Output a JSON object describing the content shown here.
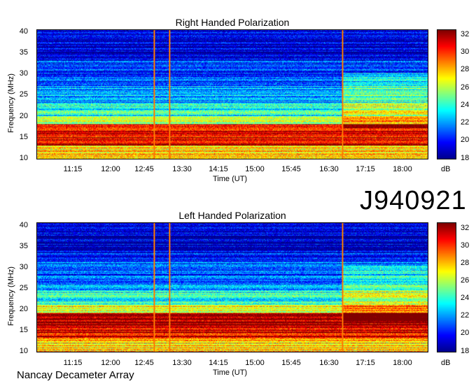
{
  "page": {
    "identifier": "J940921",
    "instrument": "Nancay Decameter Array"
  },
  "colors": {
    "colormap": [
      "#00008f",
      "#0000ff",
      "#0080ff",
      "#00ffff",
      "#80ff80",
      "#ffff00",
      "#ff8000",
      "#ff0000",
      "#800000"
    ],
    "background": "#ffffff"
  },
  "chart_data": [
    {
      "type": "heatmap",
      "title": "Right Handed Polarization",
      "xlabel": "Time (UT)",
      "ylabel": "Frequency (MHz)",
      "x_ticks": [
        "11:15",
        "12:00",
        "12:45",
        "13:30",
        "14:15",
        "15:00",
        "15:45",
        "16:30",
        "17:15",
        "18:00"
      ],
      "x_tick_minutes": [
        675,
        720,
        765,
        810,
        855,
        900,
        945,
        990,
        1035,
        1080
      ],
      "xlim_minutes": [
        616,
        1108
      ],
      "y_ticks": [
        "10",
        "15",
        "20",
        "25",
        "30",
        "35",
        "40"
      ],
      "ylim": [
        10,
        40
      ],
      "colorbar": {
        "label": "dB",
        "ticks": [
          "18",
          "20",
          "22",
          "24",
          "26",
          "28",
          "30",
          "32"
        ],
        "range": [
          18,
          33
        ]
      },
      "vertical_lines_minutes": [
        763,
        782,
        1001
      ],
      "bands": [
        {
          "f_low": 10,
          "f_high": 13,
          "db": 28
        },
        {
          "f_low": 13,
          "f_high": 15,
          "db": 32
        },
        {
          "f_low": 15,
          "f_high": 18,
          "db": 31
        },
        {
          "f_low": 18,
          "f_high": 20,
          "db": 26
        },
        {
          "f_low": 20,
          "f_high": 23,
          "db": 24
        },
        {
          "f_low": 23,
          "f_high": 27,
          "db": 22
        },
        {
          "f_low": 27,
          "f_high": 33,
          "db": 21
        },
        {
          "f_low": 33,
          "f_high": 40,
          "db": 19
        }
      ]
    },
    {
      "type": "heatmap",
      "title": "Left Handed Polarization",
      "xlabel": "Time (UT)",
      "ylabel": "Frequency (MHz)",
      "x_ticks": [
        "11:15",
        "12:00",
        "12:45",
        "13:30",
        "14:15",
        "15:00",
        "15:45",
        "16:30",
        "17:15",
        "18:00"
      ],
      "x_tick_minutes": [
        675,
        720,
        765,
        810,
        855,
        900,
        945,
        990,
        1035,
        1080
      ],
      "xlim_minutes": [
        616,
        1108
      ],
      "y_ticks": [
        "10",
        "15",
        "20",
        "25",
        "30",
        "35",
        "40"
      ],
      "ylim": [
        10,
        40
      ],
      "colorbar": {
        "label": "dB",
        "ticks": [
          "18",
          "20",
          "22",
          "24",
          "26",
          "28",
          "30",
          "32"
        ],
        "range": [
          18,
          33
        ]
      },
      "vertical_lines_minutes": [
        763,
        782,
        1001
      ],
      "bands": [
        {
          "f_low": 10,
          "f_high": 13,
          "db": 28
        },
        {
          "f_low": 13,
          "f_high": 15,
          "db": 31
        },
        {
          "f_low": 15,
          "f_high": 19,
          "db": 32
        },
        {
          "f_low": 19,
          "f_high": 21,
          "db": 27
        },
        {
          "f_low": 21,
          "f_high": 24,
          "db": 24
        },
        {
          "f_low": 24,
          "f_high": 28,
          "db": 22
        },
        {
          "f_low": 28,
          "f_high": 33,
          "db": 21
        },
        {
          "f_low": 33,
          "f_high": 40,
          "db": 19
        }
      ]
    }
  ]
}
